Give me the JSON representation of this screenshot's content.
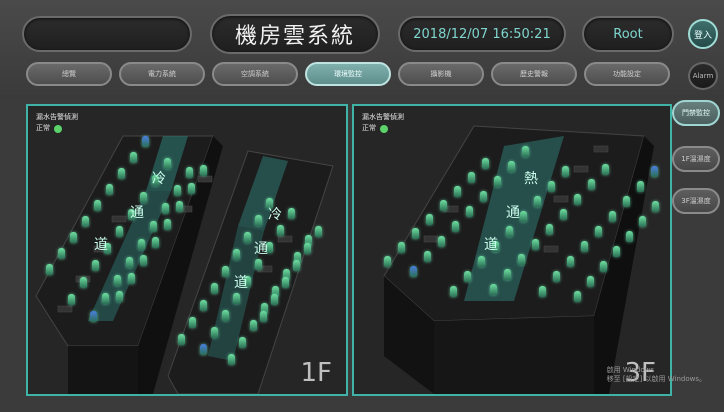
{
  "header": {
    "title": "機房雲系統",
    "datetime": "2018/12/07 16:50:21",
    "user": "Root",
    "login_label": "登入",
    "alarm_label": "Alarm"
  },
  "nav": {
    "tabs": [
      {
        "label": "總覽",
        "active": false
      },
      {
        "label": "電力系統",
        "active": false
      },
      {
        "label": "空調系統",
        "active": false
      },
      {
        "label": "環境監控",
        "active": true
      },
      {
        "label": "攝影機",
        "active": false
      },
      {
        "label": "歷史警報",
        "active": false
      },
      {
        "label": "功能設定",
        "active": false
      }
    ]
  },
  "side": {
    "items": [
      {
        "label": "門禁監控",
        "active": true
      },
      {
        "label": "1F溫濕度",
        "active": false
      },
      {
        "label": "3F溫濕度",
        "active": false
      }
    ]
  },
  "panels": [
    {
      "leak_title": "漏水告警偵測",
      "status_label": "正常",
      "floor": "1F",
      "aisle_a": [
        "冷",
        "通",
        "道"
      ],
      "aisle_b": [
        "冷",
        "通",
        "道"
      ]
    },
    {
      "leak_title": "漏水告警偵測",
      "status_label": "正常",
      "floor": "3F",
      "aisle_a": [
        "熱",
        "通",
        "道"
      ]
    }
  ],
  "watermark": {
    "line1": "啟用 Windows",
    "line2": "移至 [設定] 以啟用 Windows。"
  },
  "colors": {
    "accent": "#3fb3a6",
    "status_ok": "#5cd36a",
    "sensor": "#6fe0a0",
    "sensor_blue": "#4a7fe0"
  }
}
